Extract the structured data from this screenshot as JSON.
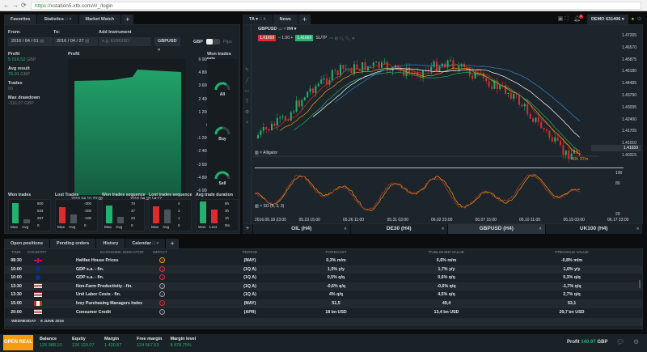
{
  "browser": {
    "url_secure": "https://",
    "url_rest": "xstation5.xtb.com/#/_/login"
  },
  "left_panel": {
    "tabs": [
      "Favorites",
      "Statistics",
      "Market Watch",
      "+"
    ],
    "from_label": "From:",
    "from_value": "2016 / 04 / 01",
    "to_label": "To:",
    "to_value": "2016 / 04 / 27",
    "add_label": "Add Instrument",
    "add_placeholder": "e.g. EURUSD",
    "instrument_chip": "GBPUSD",
    "currency_label": "GBP",
    "pips_label": "Pips",
    "stats": [
      {
        "label": "Profit",
        "value": "5 016.52",
        "unit": "GBP",
        "green": true
      },
      {
        "label": "Avg result",
        "value": "76.01",
        "unit": "GBP",
        "green": true
      },
      {
        "label": "Trades",
        "value": "66",
        "unit": "",
        "green": false
      },
      {
        "label": "Max drawdown",
        "value": "-316.07",
        "unit": "GBP",
        "green": false
      }
    ],
    "profit_title": "Profit",
    "profit_axis": [
      "6 000",
      "4 800",
      "3 600",
      "2 400",
      "1 200",
      "0",
      "-1 200",
      "-2 400",
      "-3 600",
      "-4 800",
      "-6 000"
    ],
    "profit_dates": [
      "2016.04.10 20:08",
      "2016.04.18 14:12"
    ],
    "won_rate_title": "Won trades rate",
    "gauges": [
      {
        "label": "All",
        "fraction": 0.7
      },
      {
        "label": "Buy",
        "fraction": 0.5
      },
      {
        "label": "Sell",
        "fraction": 0.85
      }
    ],
    "minis": [
      {
        "title": "Won trades",
        "axis": [
          "800",
          "533",
          "267",
          "0"
        ],
        "labels": [
          "Max",
          "Avg"
        ],
        "fractions": [
          0.88,
          0.17
        ],
        "colors": [
          "#21b26f",
          "#4a545b"
        ]
      },
      {
        "title": "Lost Trades",
        "axis": [
          "-300",
          "-200",
          "-100",
          "0"
        ],
        "labels": [
          "Max",
          "Avg"
        ],
        "fractions": [
          0.72,
          0.4
        ],
        "colors": [
          "#e02b2b",
          "#4a545b"
        ]
      },
      {
        "title": "Won trades sequence",
        "axis": [
          "70",
          "47",
          "23",
          "0"
        ],
        "labels": [
          "Max",
          "Avg"
        ],
        "fractions": [
          0.8,
          0.3
        ],
        "colors": [
          "#21b26f",
          "#4a545b"
        ]
      },
      {
        "title": "Lost trades sequence",
        "axis": [
          "4",
          "3",
          "1",
          "0"
        ],
        "labels": [
          "Max",
          "Avg"
        ],
        "fractions": [
          0.75,
          0.6
        ],
        "colors": [
          "#e02b2b",
          "#4a545b"
        ]
      },
      {
        "title": "Avg trade duration",
        "axis": [
          "5h",
          "3h",
          "1h",
          "0m"
        ],
        "labels": [
          "Won",
          "Lost"
        ],
        "fractions": [
          0.95,
          0.62
        ],
        "colors": [
          "#21b26f",
          "#e02b2b"
        ]
      }
    ]
  },
  "right_panel": {
    "tabs": [
      "TA ▾",
      "News",
      "+"
    ],
    "account": "DEMO",
    "account_id": "631406",
    "notifications": "1",
    "symbol": "GBPUSD",
    "timeframe": "H4",
    "sell_price": "1.41659",
    "volume": "1.00",
    "buy_price": "1.41685",
    "sltp": "SL/TP",
    "price_axis": [
      "1.47265",
      "1.46570",
      "1.45875",
      "1.45180",
      "1.44485",
      "1.43790",
      "1.43095",
      "1.42400",
      "1.41705",
      "1.41010",
      "1.40315"
    ],
    "current_price": "1.41659",
    "countdown_h": "00h",
    "countdown_m": "37m",
    "indicator1": "Alligator",
    "indicator2": "SO (5, 3, 3)",
    "osc_axis": [
      "100",
      "80",
      "20"
    ],
    "time_axis": [
      "2016.05.18 23:00",
      "05.23 15:00",
      "05.26 11:00",
      "05.31 03:00",
      "06.02 23:00",
      "06.07 15:00",
      "06.10 11:00",
      "06.15 03:00",
      "06.17 23:00"
    ],
    "instrument_tabs": [
      {
        "label": "OIL (H4)",
        "active": false
      },
      {
        "label": "DE30 (H4)",
        "active": false
      },
      {
        "label": "GBPUSD (H4)",
        "active": true
      },
      {
        "label": "UK100 (H4)",
        "active": false
      }
    ]
  },
  "bottom_panel": {
    "tabs": [
      "Open positions",
      "Pending orders",
      "History",
      "Calendar",
      "+"
    ],
    "headers": [
      "TIME",
      "COUNTRY",
      "ECONOMIC INDICATOR",
      "IMPACT",
      "PERIOD",
      "FORECAST",
      "PUBLISHED VALUE",
      "PREVIOUS VALUE"
    ],
    "rows": [
      {
        "time": "08:30",
        "flag": "uk",
        "indicator": "Halifax House Prices",
        "impact": "medium",
        "period": "(MAY)",
        "forecast": "0,3% m/m",
        "published": "0,6% m/m",
        "previous": "-0,8% m/m"
      },
      {
        "time": "10:00",
        "flag": "eu",
        "indicator": "GDP s.a. - fin.",
        "impact": "high",
        "period": "(1Q A)",
        "forecast": "1,5% y/y",
        "published": "1,7% y/y",
        "previous": "1,6% y/y"
      },
      {
        "time": "10:00",
        "flag": "eu",
        "indicator": "GDP s.a. - fin.",
        "impact": "high",
        "period": "(1Q A)",
        "forecast": "0,5% q/q",
        "published": "0,6% q/q",
        "previous": "0,3% q/q"
      },
      {
        "time": "13:30",
        "flag": "us",
        "indicator": "Non-Farm Productivity - fin.",
        "impact": "low",
        "period": "(1Q A)",
        "forecast": "-0,6% q/q",
        "published": "-0,6% q/q",
        "previous": "-1,7% q/q"
      },
      {
        "time": "13:30",
        "flag": "us",
        "indicator": "Unit Labor Costs - fin.",
        "impact": "low",
        "period": "(1Q A)",
        "forecast": "4% q/q",
        "published": "4,5% q/q",
        "previous": "2,7% q/q"
      },
      {
        "time": "15:00",
        "flag": "ca",
        "indicator": "Ivey Purchasing Managers Index",
        "impact": "high",
        "period": "(MAY)",
        "forecast": "51,5",
        "published": "49,4",
        "previous": "53,1"
      },
      {
        "time": "20:00",
        "flag": "us",
        "indicator": "Consumer Credit",
        "impact": "low",
        "period": "(APR)",
        "forecast": "18 bn USD",
        "published": "13,4 bn USD",
        "previous": "29,7 bn USD"
      }
    ],
    "day_label": "WEDNESDAY",
    "day_date": "8 JUNE 2016"
  },
  "footer": {
    "open_real": "OPEN REAL",
    "metrics": [
      {
        "label": "Balance",
        "value": "125 988.10"
      },
      {
        "label": "Equity",
        "value": "126 129.07"
      },
      {
        "label": "Margin",
        "value": "1 420.57"
      },
      {
        "label": "Free margin",
        "value": "124 567.53"
      },
      {
        "label": "Margin level",
        "value": "8 878.75%"
      }
    ],
    "profit_label": "Profit",
    "profit_value": "140.97",
    "profit_unit": "GBP"
  },
  "colors": {
    "green": "#21b26f",
    "red": "#e02b2b",
    "orange": "#f39c12"
  }
}
